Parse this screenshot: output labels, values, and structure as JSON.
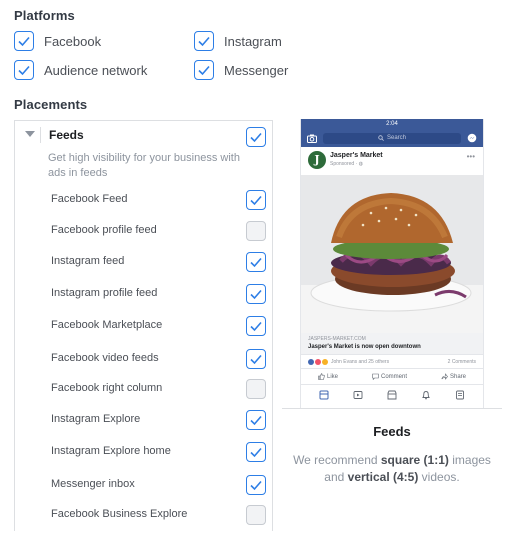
{
  "platforms": {
    "title": "Platforms",
    "items": [
      {
        "label": "Facebook",
        "checked": true
      },
      {
        "label": "Instagram",
        "checked": true
      },
      {
        "label": "Audience network",
        "checked": true
      },
      {
        "label": "Messenger",
        "checked": true
      }
    ]
  },
  "placements": {
    "title": "Placements",
    "group": {
      "label": "Feeds",
      "checked": true,
      "description": "Get high visibility for your business with ads in feeds"
    },
    "items": [
      {
        "label": "Facebook Feed",
        "checked": true
      },
      {
        "label": "Facebook profile feed",
        "checked": false
      },
      {
        "label": "Instagram feed",
        "checked": true
      },
      {
        "label": "Instagram profile feed",
        "checked": true
      },
      {
        "label": "Facebook Marketplace",
        "checked": true
      },
      {
        "label": "Facebook video feeds",
        "checked": true
      },
      {
        "label": "Facebook right column",
        "checked": false
      },
      {
        "label": "Instagram Explore",
        "checked": true
      },
      {
        "label": "Instagram Explore home",
        "checked": true
      },
      {
        "label": "Messenger inbox",
        "checked": true
      },
      {
        "label": "Facebook Business Explore",
        "checked": false
      }
    ]
  },
  "preview": {
    "status_time": "2:04",
    "search_placeholder": "Search",
    "page_name": "Jasper's Market",
    "sponsored": "Sponsored",
    "link_url": "JASPERS-MARKET.COM",
    "link_title": "Jasper's Market is now open downtown",
    "reactions_text": "John Evans and 25 others",
    "comments_text": "2 Comments",
    "like_label": "Like",
    "comment_label": "Comment",
    "share_label": "Share",
    "title": "Feeds",
    "desc_part1": "We recommend ",
    "desc_bold1": "square (1:1)",
    "desc_part2": " images and ",
    "desc_bold2": "vertical (4:5)",
    "desc_part3": " videos."
  },
  "colors": {
    "check": "#2d7ee6",
    "facebook_blue": "#3b5998"
  }
}
